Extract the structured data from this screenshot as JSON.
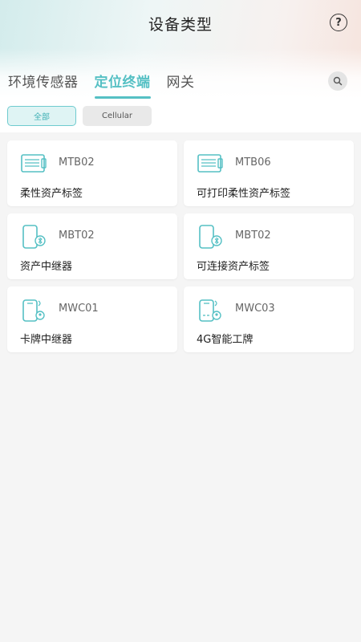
{
  "header": {
    "title": "设备类型"
  },
  "tabs": [
    {
      "label": "环境传感器",
      "active": false
    },
    {
      "label": "定位终端",
      "active": true
    },
    {
      "label": "网关",
      "active": false
    }
  ],
  "filters": [
    {
      "label": "全部",
      "active": true
    },
    {
      "label": "Cellular",
      "active": false
    }
  ],
  "devices": [
    {
      "code": "MTB02",
      "name": "柔性资产标签",
      "icon": "flexible-tag-icon"
    },
    {
      "code": "MTB06",
      "name": "可打印柔性资产标签",
      "icon": "flexible-tag-icon"
    },
    {
      "code": "MBT02",
      "name": "资产中继器",
      "icon": "bluetooth-device-icon"
    },
    {
      "code": "MBT02",
      "name": "可连接资产标签",
      "icon": "bluetooth-device-icon"
    },
    {
      "code": "MWC01",
      "name": "卡牌中继器",
      "icon": "cellular-card-icon"
    },
    {
      "code": "MWC03",
      "name": "4G智能工牌",
      "icon": "cellular-card-icon"
    }
  ],
  "colors": {
    "accent": "#55c0c4",
    "background": "#f5f5f5"
  }
}
